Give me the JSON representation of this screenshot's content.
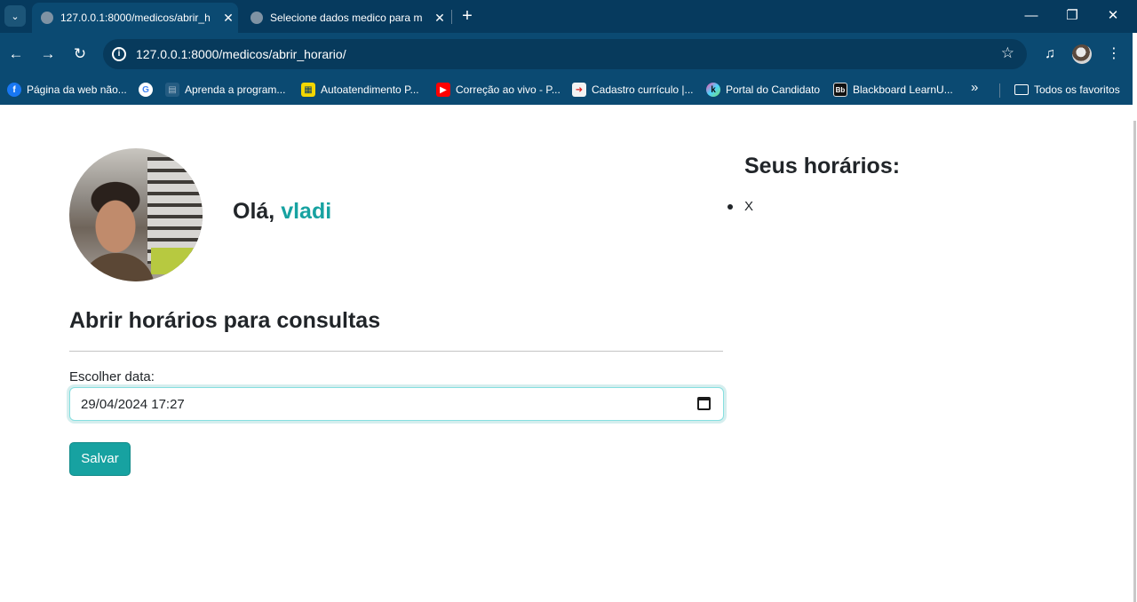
{
  "browser": {
    "tabs": [
      {
        "title": "127.0.0.1:8000/medicos/abrir_h",
        "active": true
      },
      {
        "title": "Selecione dados medico para m",
        "active": false
      }
    ],
    "url": "127.0.0.1:8000/medicos/abrir_horario/",
    "bookmarks": [
      {
        "label": "Página da web não...",
        "icon": "facebook-icon"
      },
      {
        "label": "",
        "icon": "google-icon"
      },
      {
        "label": "Aprenda a program...",
        "icon": "document-icon"
      },
      {
        "label": "Autoatendimento P...",
        "icon": "bank-icon"
      },
      {
        "label": "Correção ao vivo - P...",
        "icon": "youtube-icon"
      },
      {
        "label": "Cadastro currículo |...",
        "icon": "form-icon"
      },
      {
        "label": "Portal do Candidato",
        "icon": "k-icon"
      },
      {
        "label": "Blackboard LearnU...",
        "icon": "blackboard-icon"
      }
    ],
    "all_bookmarks_label": "Todos os favoritos"
  },
  "page": {
    "greeting_prefix": "Olá,",
    "username": "vladi",
    "section_title": "Abrir horários para consultas",
    "date_label": "Escolher data:",
    "date_value": "29/04/2024 17:27",
    "save_label": "Salvar",
    "schedule_title": "Seus horários:",
    "schedule_items": [
      "X"
    ]
  },
  "colors": {
    "accent": "#17a2a1",
    "chrome": "#0b4a72",
    "text": "#212529"
  }
}
